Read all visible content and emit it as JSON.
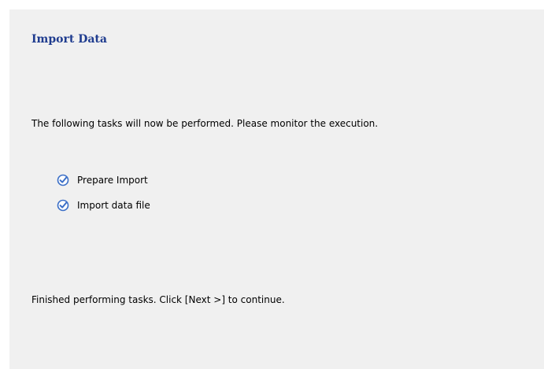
{
  "header": {
    "title": "Import Data"
  },
  "main": {
    "description": "The following tasks will now be performed. Please monitor the execution.",
    "tasks": [
      {
        "label": "Prepare Import",
        "status": "completed",
        "icon": "check-circle-icon"
      },
      {
        "label": "Import data file",
        "status": "completed",
        "icon": "check-circle-icon"
      }
    ],
    "status_message": "Finished performing tasks. Click [Next >] to continue."
  },
  "colors": {
    "title": "#1f3c8f",
    "panel_background": "#f0f0f0",
    "check_icon": "#3b6fc7"
  }
}
